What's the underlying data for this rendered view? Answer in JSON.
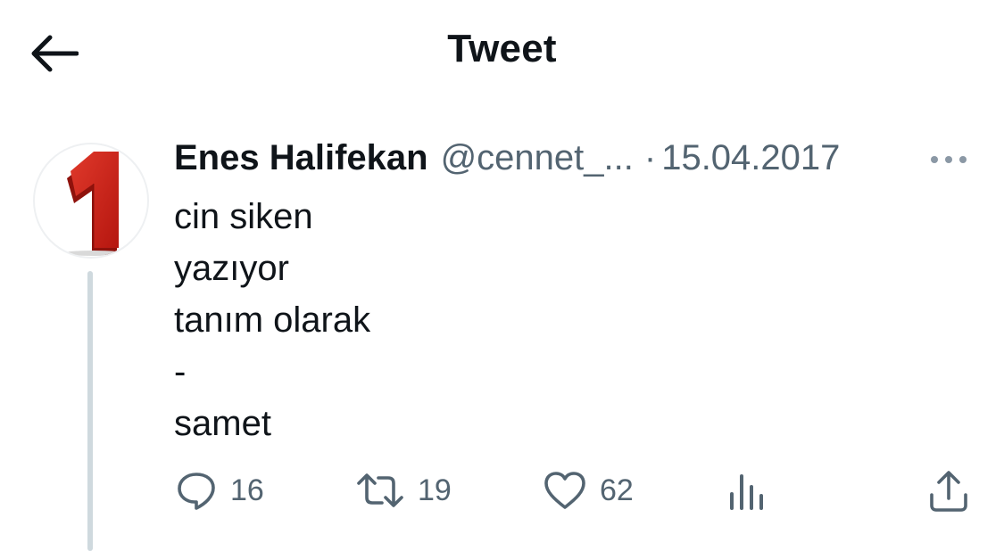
{
  "header": {
    "title": "Tweet",
    "back_icon": "arrow-left-icon"
  },
  "tweet": {
    "author_name": "Enes Halifekan",
    "handle": "@cennet_...",
    "separator": "·",
    "date": "15.04.2017",
    "avatar_text": "1",
    "lines": [
      "cin siken",
      "yazıyor",
      "tanım olarak",
      "-",
      "samet"
    ]
  },
  "actions": {
    "replies": "16",
    "retweets": "19",
    "likes": "62",
    "icons": [
      "reply-icon",
      "retweet-icon",
      "like-icon",
      "analytics-icon",
      "share-icon"
    ]
  },
  "colors": {
    "text": "#0f1419",
    "secondary": "#536471",
    "thread_line": "#cfd9de",
    "avatar_red": "#c8201a"
  }
}
